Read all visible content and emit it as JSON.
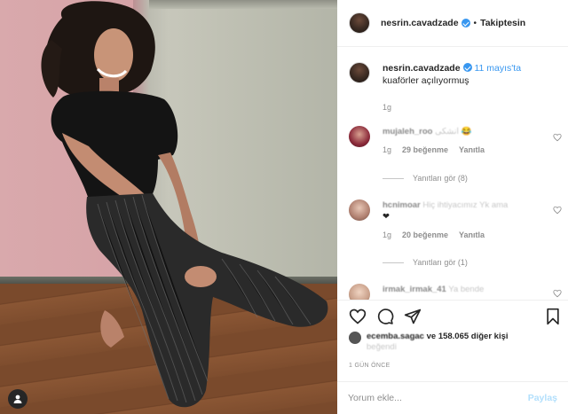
{
  "post": {
    "author": "nesrin.cavadzade",
    "follow_status": "Takiptesin",
    "separator": "•",
    "caption_date": "11 mayıs'ta",
    "caption_text": "kuaförler açılıyormuş",
    "caption_age": "1g"
  },
  "comments": [
    {
      "user": "mujaleh_roo",
      "text": "انشکی 😂",
      "age": "1g",
      "likes": "29 beğenme",
      "reply_label": "Yanıtla",
      "view_replies": "Yanıtları gör (8)",
      "avatar_color": "#8b2a3a"
    },
    {
      "user": "hcnimoar",
      "text": "Hiç ihtiyacımız Yk ama",
      "text2": "❤",
      "age": "1g",
      "likes": "20 beğenme",
      "reply_label": "Yanıtla",
      "view_replies": "Yanıtları gör (1)",
      "avatar_color": "#b08070"
    },
    {
      "user": "irmak_irmak_41",
      "text": "Ya bende",
      "avatar_color": "#c9a08a"
    }
  ],
  "likes": {
    "liker": "ecemba.sagac",
    "others": "ve 158.065 diğer kişi",
    "suffix": "beğendi"
  },
  "time_ago": "1 GÜN ÖNCE",
  "comment_input": {
    "placeholder": "Yorum ekle...",
    "post_label": "Paylaş"
  },
  "icons": {
    "like": "heart-icon",
    "comment": "comment-bubble-icon",
    "share": "paper-plane-icon",
    "save": "bookmark-icon",
    "user": "user-icon"
  },
  "colors": {
    "accent": "#3897f0",
    "muted": "#8e8e8e",
    "post_disabled": "#b2dffc"
  }
}
